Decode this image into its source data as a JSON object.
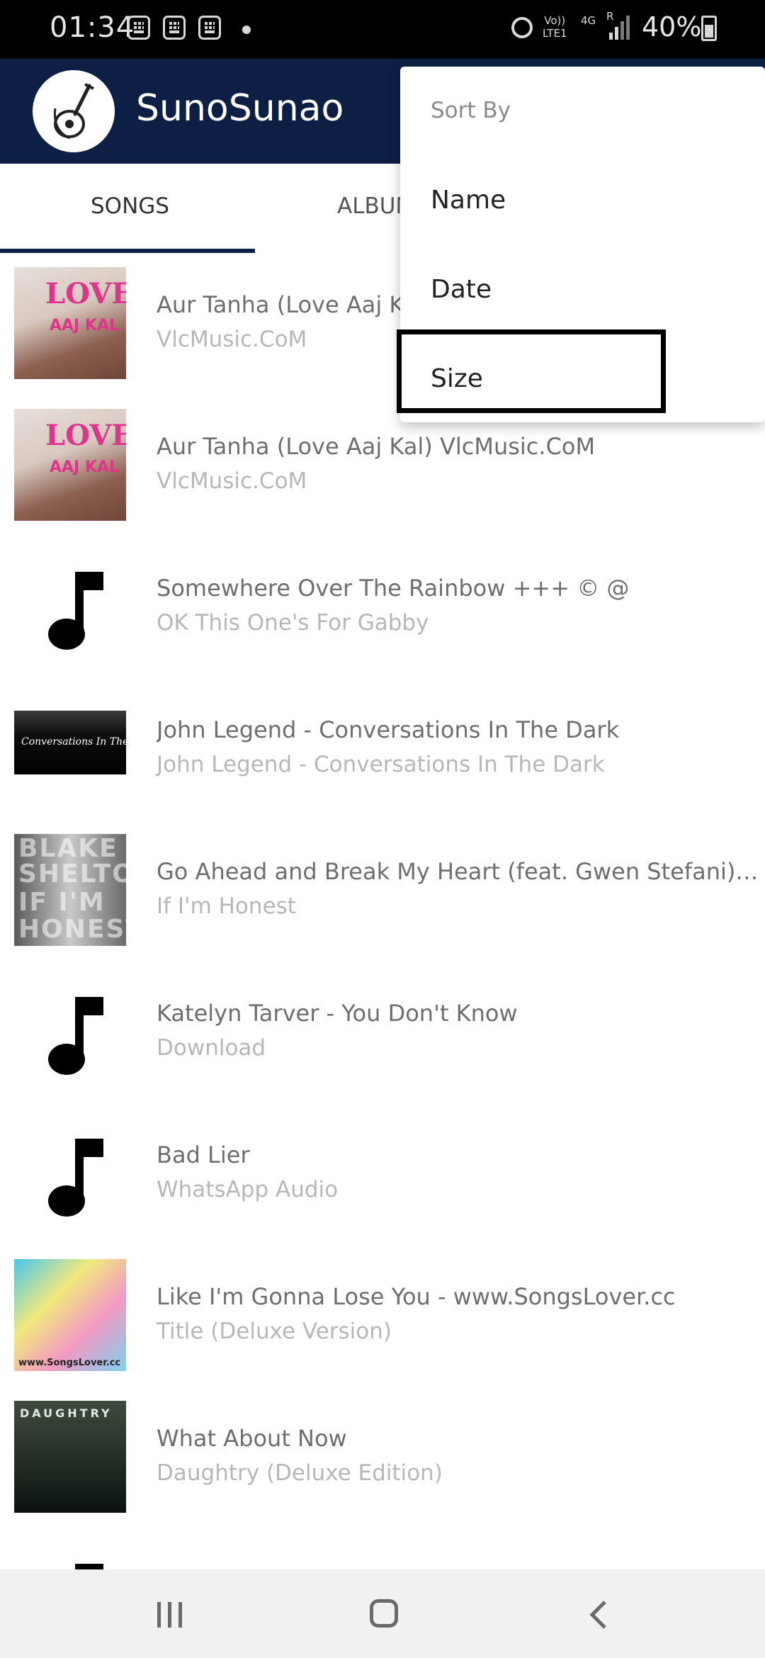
{
  "status_bar": {
    "time": "01:34",
    "network_top": "Vo))",
    "network_bottom": "LTE1",
    "network_type": "4G",
    "roaming": "R",
    "battery": "40%",
    "icons": [
      "notification-icon",
      "notification-icon",
      "notification-icon",
      "dot-icon",
      "alarm-icon",
      "signal-icon",
      "battery-icon"
    ]
  },
  "app_bar": {
    "title": "SunoSunao",
    "logo_icon": "guitar-logo-icon",
    "color": "#0d1f44"
  },
  "tabs": [
    {
      "label": "SONGS",
      "active": true
    },
    {
      "label": "ALBUMS",
      "active": false
    }
  ],
  "sort_menu": {
    "header": "Sort By",
    "items": [
      {
        "label": "Name"
      },
      {
        "label": "Date"
      },
      {
        "label": "Size",
        "highlighted": true
      }
    ]
  },
  "songs": [
    {
      "title": "Aur Tanha (Love Aaj Kal) VlcMusic.CoM",
      "subtitle": "VlcMusic.CoM",
      "art": "love-aaj-kal-art",
      "art_text_1": "LOVE",
      "art_text_2": "AAJ KAL"
    },
    {
      "title": "Aur Tanha (Love Aaj Kal) VlcMusic.CoM",
      "subtitle": "VlcMusic.CoM",
      "art": "love-aaj-kal-art",
      "art_text_1": "LOVE",
      "art_text_2": "AAJ KAL"
    },
    {
      "title": "Somewhere Over The Rainbow +++ © @",
      "subtitle": "OK This One's For Gabby",
      "art": "music-note-icon"
    },
    {
      "title": "John Legend - Conversations In The Dark",
      "subtitle": "John Legend - Conversations In The Dark",
      "art": "conversations-in-the-dark-art",
      "art_text_1": "Conversations In The Dark"
    },
    {
      "title": "Go Ahead and Break My Heart (feat. Gwen Stefani) [FazMusic.Net]",
      "subtitle": "If I'm Honest",
      "art": "blake-shelton-art",
      "art_text_1": "BLAKE",
      "art_text_2": "SHELTON",
      "art_text_3": "IF I'M",
      "art_text_4": "HONEST"
    },
    {
      "title": "Katelyn Tarver - You Don't Know",
      "subtitle": "Download",
      "art": "music-note-icon"
    },
    {
      "title": "Bad Lier",
      "subtitle": "WhatsApp Audio",
      "art": "music-note-icon"
    },
    {
      "title": "Like I'm Gonna Lose You - www.SongsLover.cc",
      "subtitle": "Title (Deluxe Version)",
      "art": "meghan-trainor-art",
      "art_text_1": "www.SongsLover.cc"
    },
    {
      "title": "What About Now",
      "subtitle": "Daughtry (Deluxe Edition)",
      "art": "daughtry-art",
      "art_text_1": "DAUGHTRY"
    }
  ],
  "nav_bar": {
    "items": [
      "recent-apps-icon",
      "home-icon",
      "back-icon"
    ]
  }
}
